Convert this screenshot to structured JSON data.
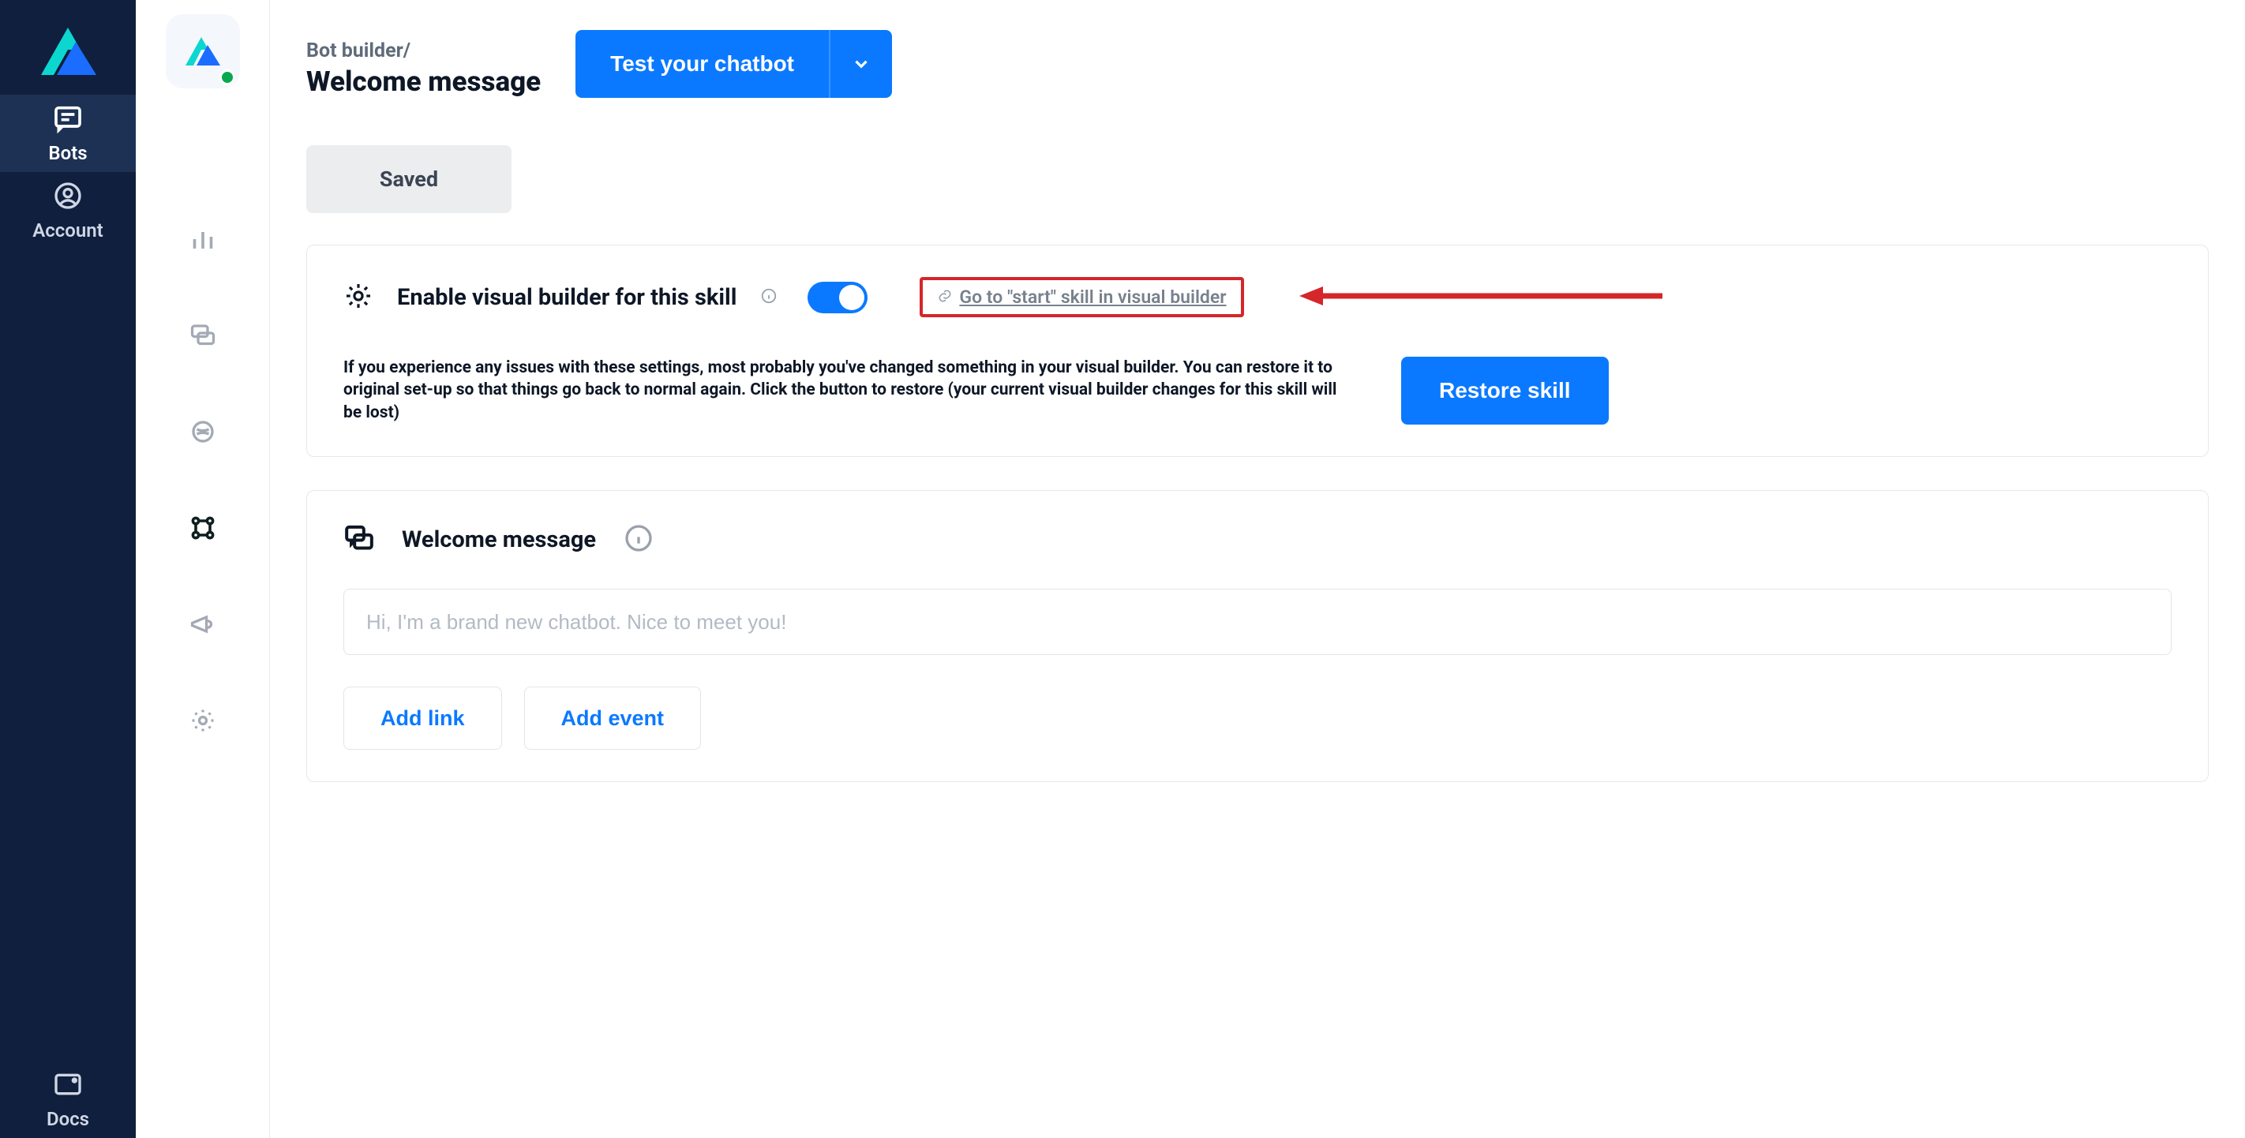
{
  "rail": {
    "bots": "Bots",
    "account": "Account",
    "docs": "Docs"
  },
  "header": {
    "breadcrumb": "Bot builder/",
    "title": "Welcome message",
    "test_label": "Test your chatbot"
  },
  "status": {
    "saved": "Saved"
  },
  "builder_card": {
    "enable_label": "Enable visual builder for this skill",
    "goto_link": "Go to \"start\" skill in visual builder",
    "restore_note": "If you experience any issues with these settings, most probably you've changed something in your visual builder. You can restore it to original set-up so that things go back to normal again. Click the button to restore (your current visual builder changes for this skill will be lost)",
    "restore_label": "Restore skill"
  },
  "welcome_card": {
    "title": "Welcome message",
    "placeholder": "Hi, I'm a brand new chatbot. Nice to meet you!",
    "add_link": "Add link",
    "add_event": "Add event"
  }
}
